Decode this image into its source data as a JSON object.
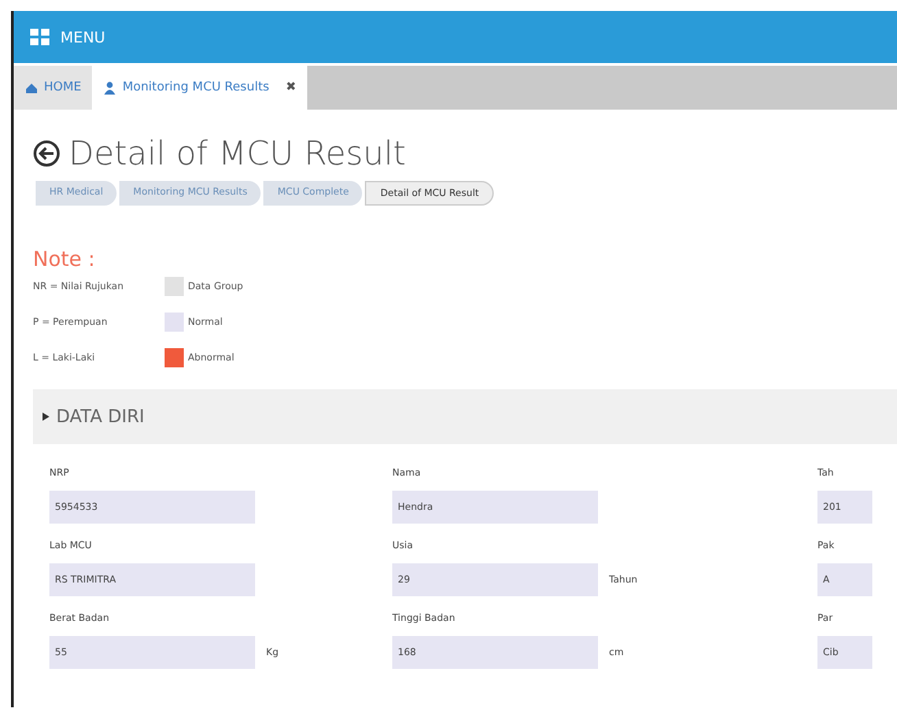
{
  "menu_bar": {
    "label": "MENU"
  },
  "tabs": [
    {
      "label": "HOME",
      "selected": false
    },
    {
      "label": "Monitoring MCU Results",
      "selected": true,
      "close": "✖"
    }
  ],
  "page": {
    "title": "Detail of MCU Result"
  },
  "breadcrumb": [
    "HR Medical",
    "Monitoring MCU Results",
    "MCU Complete",
    "Detail of MCU Result"
  ],
  "note": {
    "title": "Note :",
    "legend": [
      {
        "text": "NR = Nilai Rujukan",
        "label": "Data Group",
        "color": "#e2e2e2"
      },
      {
        "text": "P = Perempuan",
        "label": "Normal",
        "color": "#e4e2f2"
      },
      {
        "text": "L = Laki-Laki",
        "label": "Abnormal",
        "color": "#f05a3c"
      }
    ]
  },
  "section": {
    "title": "DATA DIRI",
    "expanded": true,
    "rows": [
      [
        {
          "label": "NRP",
          "value": "5954533"
        },
        {
          "label": "Nama",
          "value": "Hendra"
        },
        {
          "label": "Tah",
          "value": "201"
        }
      ],
      [
        {
          "label": "Lab MCU",
          "value": "RS TRIMITRA"
        },
        {
          "label": "Usia",
          "value": "29",
          "unit": "Tahun"
        },
        {
          "label": "Pak",
          "value": "A"
        }
      ],
      [
        {
          "label": "Berat Badan",
          "value": "55",
          "unit": "Kg"
        },
        {
          "label": "Tinggi Badan",
          "value": "168",
          "unit": "cm"
        },
        {
          "label": "Par",
          "value": "Cib"
        }
      ]
    ]
  }
}
